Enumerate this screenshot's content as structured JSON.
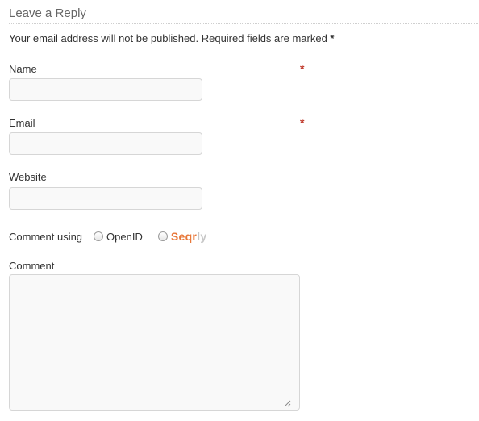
{
  "form": {
    "heading": "Leave a Reply",
    "note_text": "Your email address will not be published. Required fields are marked",
    "note_star": "*",
    "required_marker": "*",
    "fields": {
      "name": {
        "label": "Name",
        "value": "",
        "placeholder": "",
        "required": true
      },
      "email": {
        "label": "Email",
        "value": "",
        "placeholder": "",
        "required": true
      },
      "website": {
        "label": "Website",
        "value": "",
        "placeholder": "",
        "required": false
      }
    },
    "comment_using": {
      "label": "Comment using",
      "options": [
        {
          "label": "OpenID",
          "selected": false
        },
        {
          "brand_part1": "Seqr",
          "brand_part2": "ly",
          "selected": false
        }
      ]
    },
    "comment": {
      "label": "Comment",
      "value": ""
    }
  },
  "colors": {
    "required": "#c0392b",
    "brand_primary": "#e8783a",
    "brand_secondary": "#c7c7c7",
    "field_bg": "#f9f9f9",
    "field_border": "#d6d6d6"
  },
  "icons": {
    "resize_grip": "resize-grip-icon"
  }
}
